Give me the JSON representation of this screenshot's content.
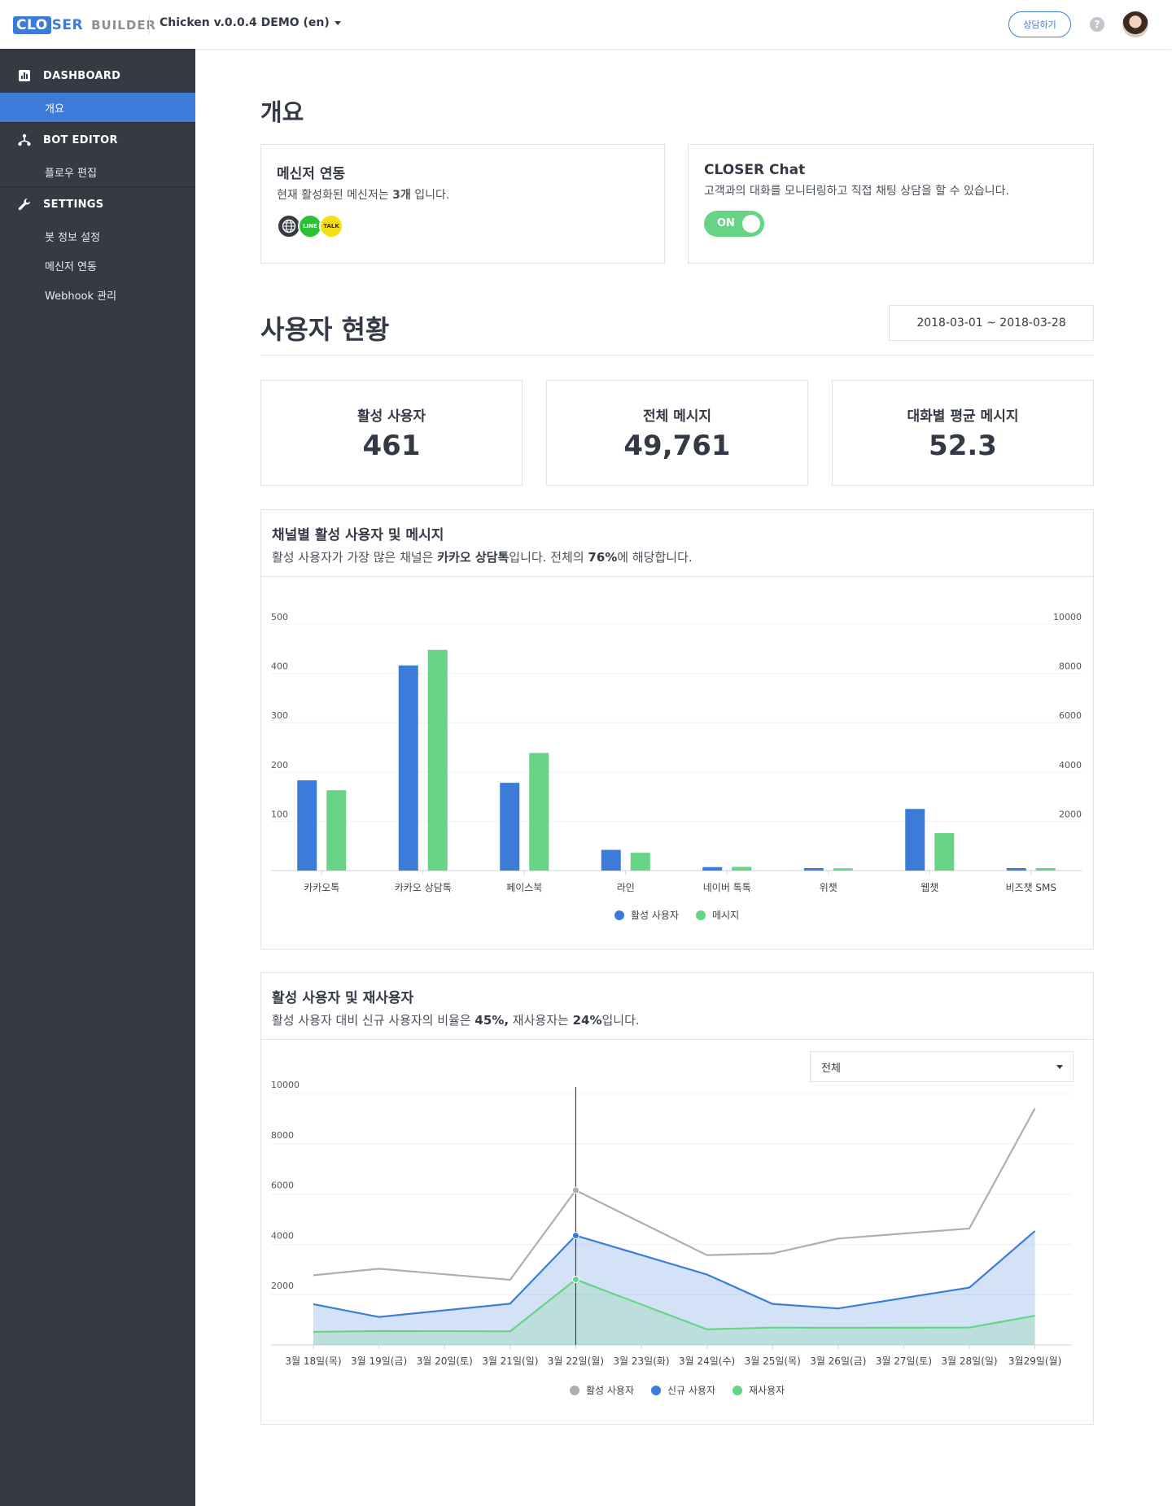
{
  "header": {
    "logo_clo": "CLO",
    "logo_ser": "SER",
    "logo_builder": "BUILDER",
    "project": "Chicken v.0.0.4 DEMO (en)",
    "consult_button": "상담하기",
    "help": "?"
  },
  "sidebar": {
    "sections": [
      {
        "label": "DASHBOARD",
        "icon": "bar-chart-icon",
        "items": [
          {
            "label": "개요",
            "active": true
          }
        ]
      },
      {
        "label": "BOT EDITOR",
        "icon": "flow-icon",
        "items": [
          {
            "label": "플로우 편집",
            "active": false
          }
        ]
      },
      {
        "label": "SETTINGS",
        "icon": "wrench-icon",
        "items": [
          {
            "label": "봇 정보 설정",
            "active": false
          },
          {
            "label": "메신저 연동",
            "active": false
          },
          {
            "label": "Webhook 관리",
            "active": false
          }
        ]
      }
    ]
  },
  "overview": {
    "title": "개요",
    "messenger": {
      "title": "메신저 연동",
      "desc_prefix": "현재 활성화된 메신저는 ",
      "desc_count": "3개",
      "desc_suffix": " 입니다.",
      "icons": [
        "globe-icon",
        "line-icon",
        "kakaotalk-icon"
      ],
      "line_text": "LINE",
      "talk_text": "TALK"
    },
    "closer_chat": {
      "title": "CLOSER Chat",
      "desc": "고객과의 대화를 모니터링하고 직접 채팅 상담을 할 수 있습니다.",
      "toggle_label": "ON"
    }
  },
  "users": {
    "title": "사용자 현황",
    "date_range": "2018-03-01 ~ 2018-03-28",
    "stats": [
      {
        "label": "활성 사용자",
        "value": "461"
      },
      {
        "label": "전체 메시지",
        "value": "49,761"
      },
      {
        "label": "대화별 평균 메시지",
        "value": "52.3"
      }
    ]
  },
  "channel_chart": {
    "title": "채널별 활성 사용자 및 메시지",
    "desc_a": "활성 사용자가 가장 많은 채널은 ",
    "desc_b": "카카오 상담톡",
    "desc_c": "입니다. 전체의 ",
    "desc_d": "76%",
    "desc_e": "에 해당합니다."
  },
  "retention_chart": {
    "title": "활성 사용자 및 재사용자",
    "desc_a": "활성 사용자 대비 신규 사용자의 비율은 ",
    "desc_b": "45%,",
    "desc_c": " 재사용자는 ",
    "desc_d": "24%",
    "desc_e": "입니다.",
    "filter": "전체"
  },
  "colors": {
    "blue": "#3d7bd9",
    "green": "#67d485",
    "gray": "#aab0b8",
    "sidebar": "#353a43"
  },
  "chart_data": [
    {
      "type": "bar",
      "categories": [
        "카카오톡",
        "카카오 상담톡",
        "페이스북",
        "라인",
        "네이버 톡톡",
        "위챗",
        "웹챗",
        "비즈챗 SMS"
      ],
      "series": [
        {
          "name": "활성 사용자",
          "axis": "left",
          "values": [
            183,
            416,
            178,
            42,
            7,
            5,
            125,
            5
          ]
        },
        {
          "name": "메시지",
          "axis": "right",
          "values": [
            3260,
            8950,
            4770,
            720,
            150,
            90,
            1520,
            100
          ]
        }
      ],
      "yticks_left": [
        100,
        200,
        300,
        400,
        500
      ],
      "yticks_right": [
        2000,
        4000,
        6000,
        8000,
        10000
      ],
      "ylim_left": [
        0,
        500
      ],
      "ylim_right": [
        0,
        10000
      ],
      "legend": "bottom",
      "grid": true
    },
    {
      "type": "area",
      "categories": [
        "3월 18일(목)",
        "3월 19일(금)",
        "3월 20일(토)",
        "3월 21일(일)",
        "3월 22일(월)",
        "3월 23일(화)",
        "3월 24일(수)",
        "3월 25일(목)",
        "3월 26일(금)",
        "3월 27일(토)",
        "3월 28일(일)",
        "3월29일(월)"
      ],
      "series": [
        {
          "name": "활성 사용자",
          "values": [
            2770,
            3030,
            2590,
            6150,
            3570,
            3640,
            4230,
            4630,
            9410
          ]
        },
        {
          "name": "신규 사용자",
          "values": [
            1620,
            1110,
            1640,
            4350,
            2800,
            1630,
            1450,
            2280,
            4530
          ]
        },
        {
          "name": "재사용자",
          "values": [
            520,
            550,
            540,
            2600,
            620,
            690,
            680,
            690,
            1160
          ]
        }
      ],
      "point_categories": [
        "3월 18일(목)",
        "3월 19일(금)",
        "3월 21일(일)",
        "3월 22일(월)",
        "3월 24일(수)",
        "3월 25일(목)",
        "3월 26일(금)",
        "3월 28일(일)",
        "3월29일(월)"
      ],
      "yticks": [
        2000,
        4000,
        6000,
        8000,
        10000
      ],
      "ylim": [
        0,
        10000
      ],
      "highlight_category": "3월 22일(월)",
      "legend": "bottom",
      "grid": true
    }
  ]
}
